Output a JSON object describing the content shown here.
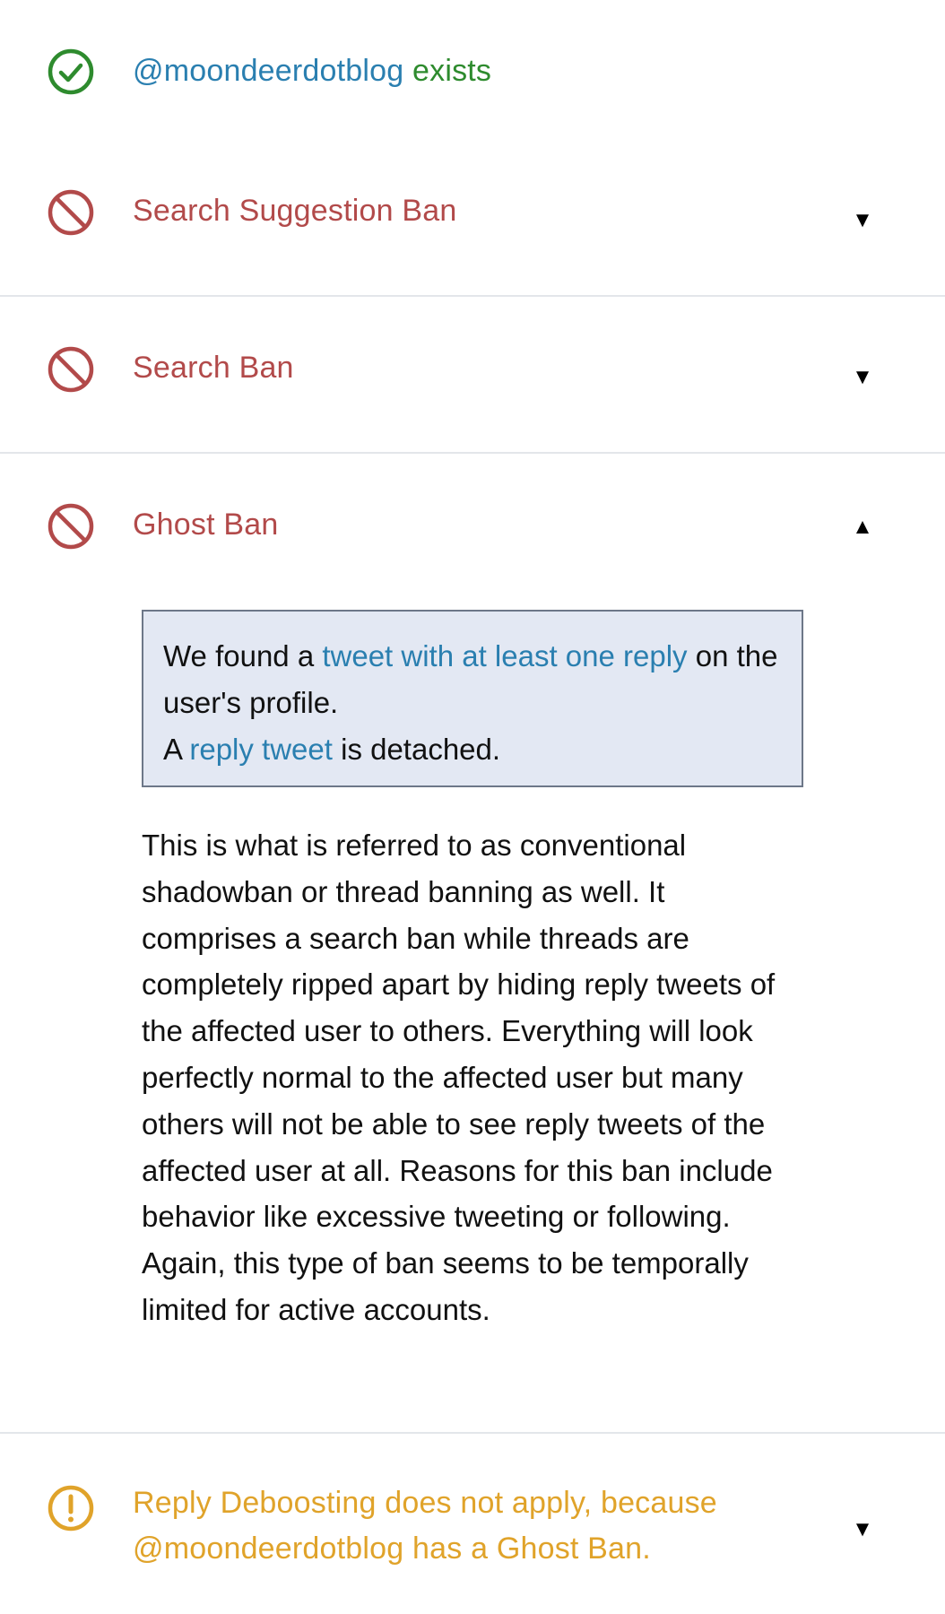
{
  "checks": {
    "exists": {
      "handle": "@moondeerdotblog",
      "status_text": " exists",
      "icon": "check-circle-icon",
      "color": "#2e8b2e"
    },
    "search_suggestion_ban": {
      "title": "Search Suggestion Ban",
      "icon": "ban-icon",
      "toggle": "▼",
      "color": "#b24a4a"
    },
    "search_ban": {
      "title": "Search Ban",
      "icon": "ban-icon",
      "toggle": "▼",
      "color": "#b24a4a"
    },
    "ghost_ban": {
      "title": "Ghost Ban",
      "icon": "ban-icon",
      "toggle": "▲",
      "color": "#b24a4a",
      "notice": {
        "part1": "We found a ",
        "link1": "tweet with at least one reply",
        "part2": " on the user's profile.",
        "part3": "A ",
        "link2": "reply tweet",
        "part4": " is detached."
      },
      "description": "This is what is referred to as conventional shadowban or thread banning as well. It comprises a search ban while threads are completely ripped apart by hiding reply tweets of the affected user to others. Everything will look perfectly normal to the affected user but many others will not be able to see reply tweets of the affected user at all. Reasons for this ban include behavior like excessive tweeting or following. Again, this type of ban seems to be temporally limited for active accounts."
    },
    "reply_deboosting": {
      "title_line1": "Reply Deboosting does not apply, because",
      "title_line2": "@moondeerdotblog has a Ghost Ban.",
      "icon": "exclamation-circle-icon",
      "toggle": "▼",
      "color": "#e0a32a"
    }
  }
}
